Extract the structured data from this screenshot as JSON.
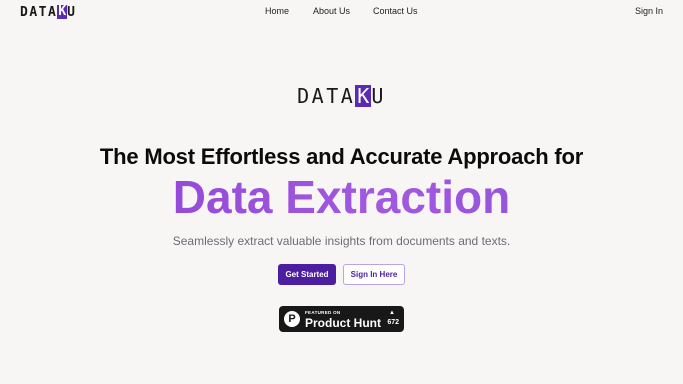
{
  "nav": {
    "logo_prefix": "DATA",
    "logo_box": "K",
    "logo_suffix": "U",
    "links": {
      "home": "Home",
      "about": "About Us",
      "contact": "Contact Us"
    },
    "sign_in": "Sign In"
  },
  "hero": {
    "logo_prefix": "DATA",
    "logo_box": "K",
    "logo_suffix": "U",
    "headline": "The Most Effortless and Accurate Approach for",
    "headline_accent": "Data Extraction",
    "subtitle": "Seamlessly extract valuable insights from documents and texts.",
    "primary_button": "Get Started",
    "secondary_button": "Sign In Here",
    "accent_color": "#4b1fa0",
    "gradient_color": "#9b52db"
  },
  "product_hunt": {
    "icon": "P",
    "featured_label": "FEATURED ON",
    "name": "Product Hunt",
    "upvote_icon": "▲",
    "votes": "672"
  }
}
